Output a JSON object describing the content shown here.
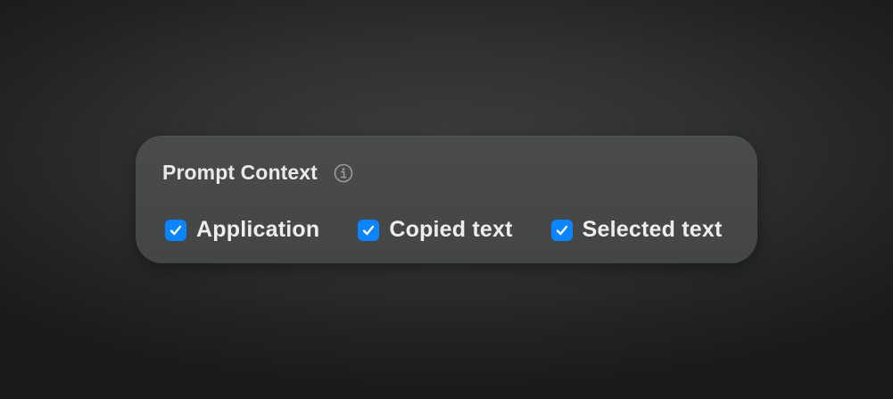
{
  "prompt_context": {
    "title": "Prompt Context",
    "info_icon": "info-icon",
    "options": [
      {
        "label": "Application",
        "checked": true
      },
      {
        "label": "Copied text",
        "checked": true
      },
      {
        "label": "Selected text",
        "checked": true
      }
    ]
  },
  "colors": {
    "checkbox_accent": "#0a84ff",
    "panel_background": "#464848",
    "text": "#ededed"
  }
}
